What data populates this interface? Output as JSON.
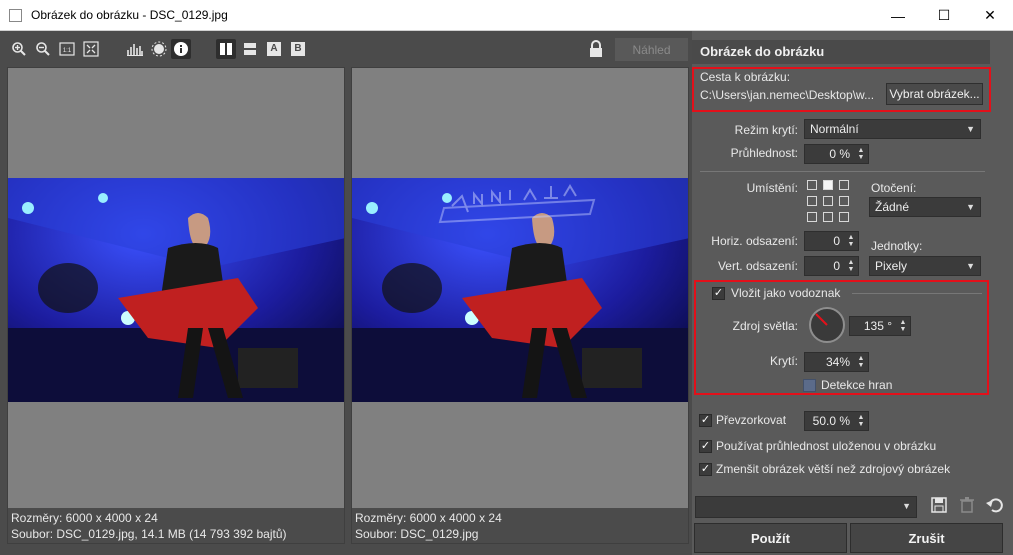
{
  "window": {
    "title": "Obrázek do obrázku - DSC_0129.jpg",
    "minimize": "—",
    "maximize": "☐",
    "close": "✕"
  },
  "toolbar": {
    "compare_a": "A",
    "compare_b": "B",
    "preview_label": "Náhled"
  },
  "left_pane": {
    "dimensions": "Rozměry: 6000 x 4000 x 24",
    "file": "Soubor: DSC_0129.jpg, 14.1 MB (14 793 392 bajtů)"
  },
  "right_pane": {
    "dimensions": "Rozměry: 6000 x 4000 x 24",
    "file": "Soubor: DSC_0129.jpg"
  },
  "panel": {
    "header": "Obrázek do obrázku",
    "path_label": "Cesta k obrázku:",
    "path_value": "C:\\Users\\jan.nemec\\Desktop\\w...",
    "choose_button": "Vybrat obrázek...",
    "blend_label": "Režim krytí:",
    "blend_value": "Normální",
    "opacity_label": "Průhlednost:",
    "opacity_value": "0 %",
    "placement_label": "Umístění:",
    "rotation_label": "Otočení:",
    "rotation_value": "Žádné",
    "horiz_label": "Horiz. odsazení:",
    "horiz_value": "0",
    "vert_label": "Vert. odsazení:",
    "vert_value": "0",
    "units_label": "Jednotky:",
    "units_value": "Pixely",
    "watermark_label": "Vložit jako vodoznak",
    "light_label": "Zdroj světla:",
    "light_value": "135 °",
    "cover_label": "Krytí:",
    "cover_value": "34%",
    "edge_label": "Detekce hran",
    "resample_label": "Převzorkovat",
    "resample_value": "50.0 %",
    "use_alpha_label": "Používat průhlednost uloženou v obrázku",
    "shrink_label": "Zmenšit obrázek větší než zdrojový obrázek",
    "preset_value": "",
    "apply_button": "Použít",
    "cancel_button": "Zrušit"
  },
  "colors": {
    "highlight": "#e3101a",
    "stage_blue": "#1a1a7a"
  }
}
